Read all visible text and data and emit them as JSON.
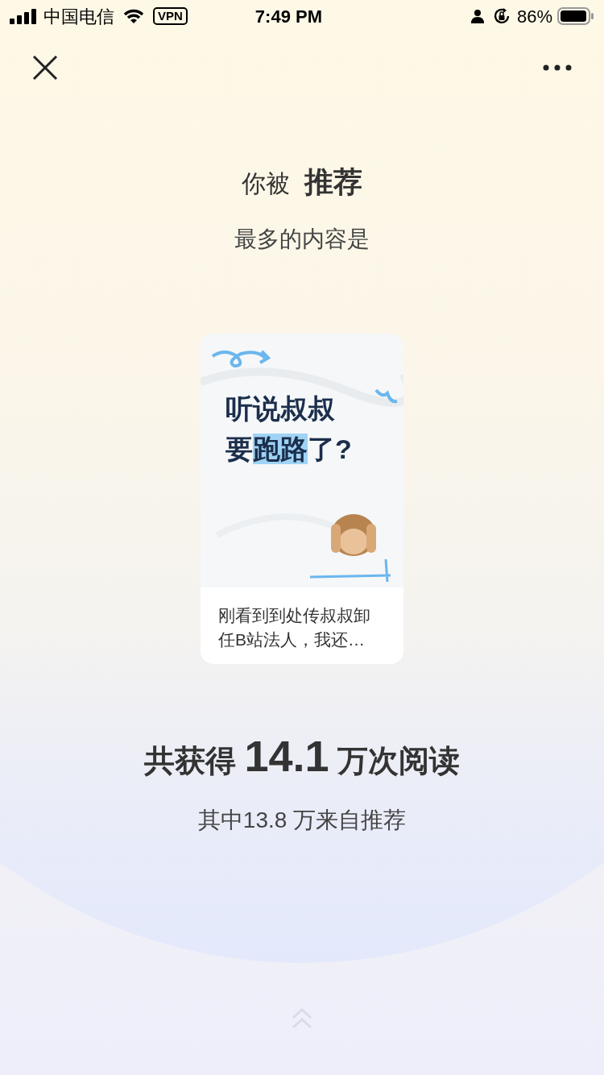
{
  "status_bar": {
    "carrier": "中国电信",
    "vpn": "VPN",
    "time": "7:49 PM",
    "battery": "86%"
  },
  "headline": "你被 **推荐**",
  "subheadline": "最多的内容是",
  "card": {
    "cover_lines": [
      "听说叔叔",
      "要**跑路**了?"
    ],
    "caption": "刚看到到处传叔叔卸任B站法人，我还…"
  },
  "stats": {
    "total": "共获得 **14.1** 万次阅读",
    "detail": "其中13.8 万来自推荐"
  }
}
